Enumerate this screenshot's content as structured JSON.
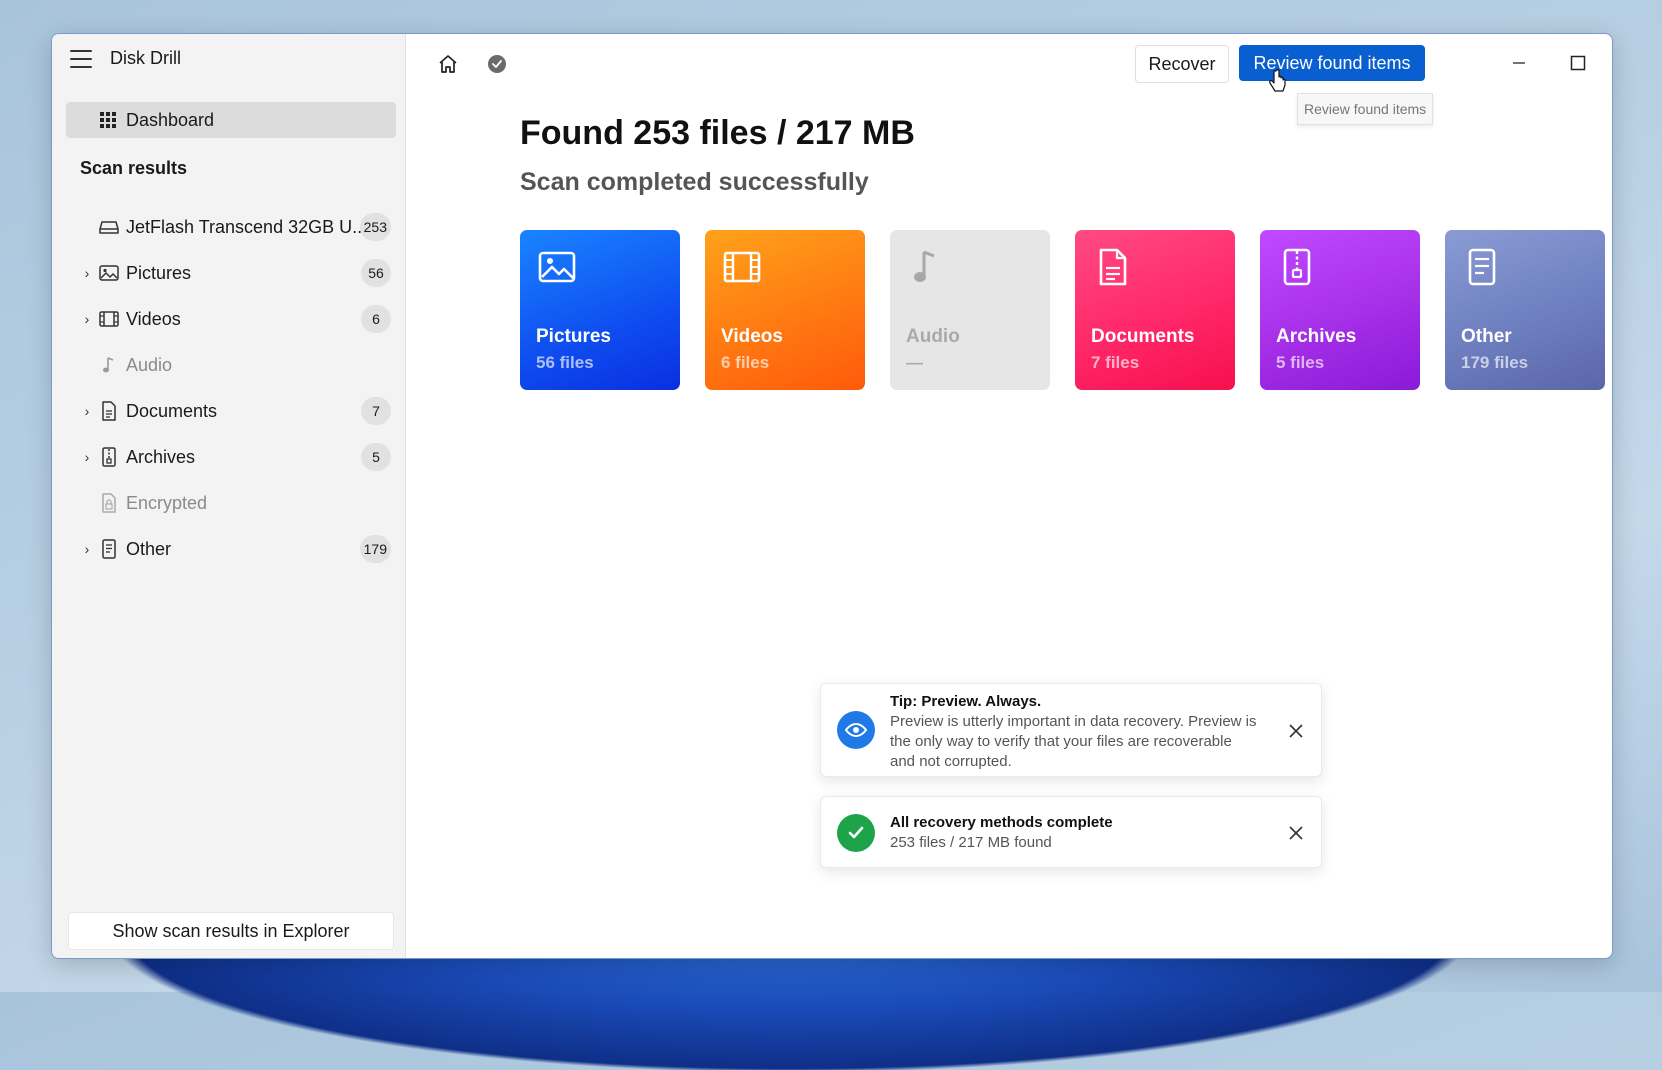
{
  "app": {
    "title": "Disk Drill"
  },
  "sidebar": {
    "dashboard_label": "Dashboard",
    "section_title": "Scan results",
    "items": [
      {
        "label": "JetFlash Transcend 32GB U...",
        "count": "253",
        "icon": "drive-icon",
        "expandable": false,
        "disabled": false
      },
      {
        "label": "Pictures",
        "count": "56",
        "icon": "image-icon",
        "expandable": true,
        "disabled": false
      },
      {
        "label": "Videos",
        "count": "6",
        "icon": "film-icon",
        "expandable": true,
        "disabled": false
      },
      {
        "label": "Audio",
        "count": "",
        "icon": "music-note-icon",
        "expandable": false,
        "disabled": true
      },
      {
        "label": "Documents",
        "count": "7",
        "icon": "document-icon",
        "expandable": true,
        "disabled": false
      },
      {
        "label": "Archives",
        "count": "5",
        "icon": "archive-icon",
        "expandable": true,
        "disabled": false
      },
      {
        "label": "Encrypted",
        "count": "",
        "icon": "lock-file-icon",
        "expandable": false,
        "disabled": true
      },
      {
        "label": "Other",
        "count": "179",
        "icon": "other-file-icon",
        "expandable": true,
        "disabled": false
      }
    ],
    "explorer_button": "Show scan results in Explorer"
  },
  "toolbar": {
    "recover_label": "Recover",
    "review_label": "Review found items",
    "tooltip": "Review found items"
  },
  "main": {
    "title": "Found 253 files / 217 MB",
    "subtitle": "Scan completed successfully",
    "cards": [
      {
        "name": "Pictures",
        "count": "56 files",
        "icon": "image-icon"
      },
      {
        "name": "Videos",
        "count": "6 files",
        "icon": "film-icon"
      },
      {
        "name": "Audio",
        "count": "—",
        "icon": "music-note-icon"
      },
      {
        "name": "Documents",
        "count": "7 files",
        "icon": "document-icon"
      },
      {
        "name": "Archives",
        "count": "5 files",
        "icon": "archive-icon"
      },
      {
        "name": "Other",
        "count": "179 files",
        "icon": "other-file-icon"
      }
    ]
  },
  "toasts": [
    {
      "title": "Tip: Preview. Always.",
      "body": "Preview is utterly important in data recovery. Preview is the only way to verify that your files are recoverable and not corrupted.",
      "icon": "eye-icon"
    },
    {
      "title": "All recovery methods complete",
      "body": "253 files / 217 MB found",
      "icon": "check-icon"
    }
  ],
  "colors": {
    "accent": "#0a5fd0",
    "pictures": "#1a6cff",
    "videos": "#ff8a14",
    "documents": "#ff2a6a",
    "archives": "#a82fe8",
    "other": "#6e7fc0",
    "success": "#1fa34a"
  }
}
